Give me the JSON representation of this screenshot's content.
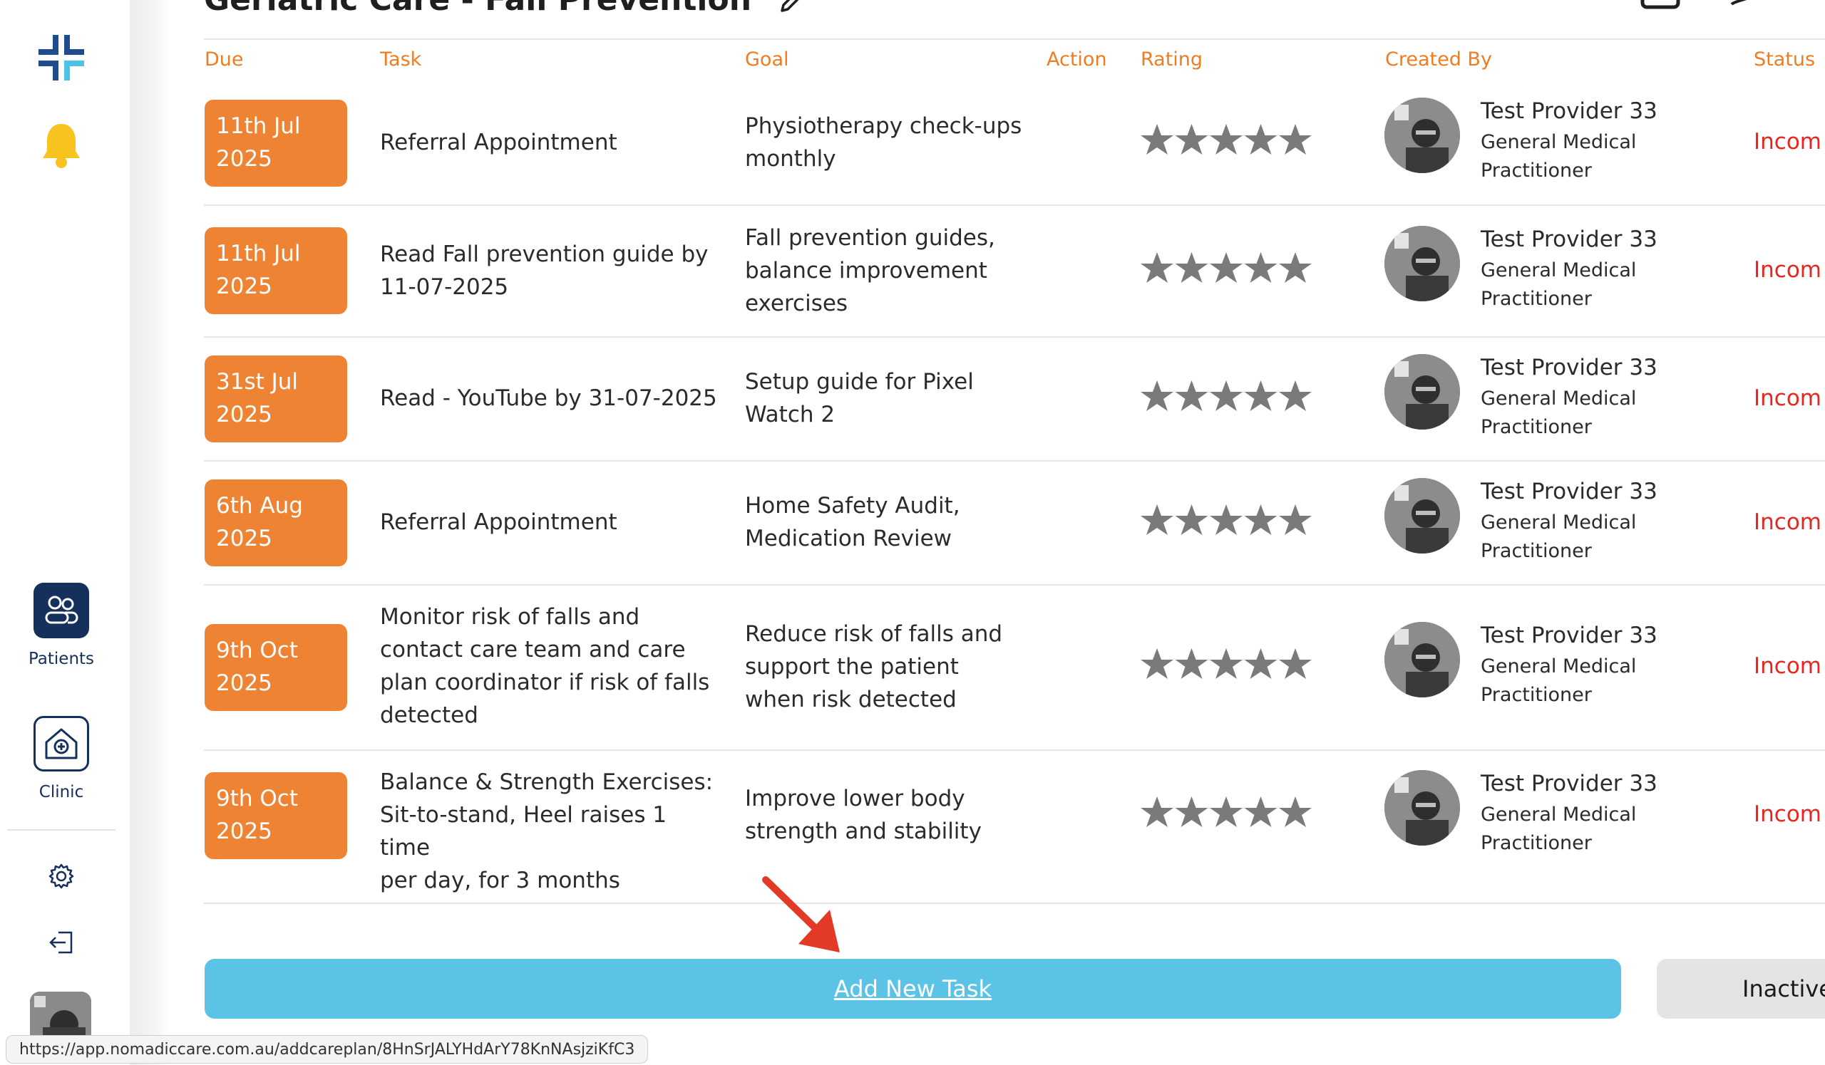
{
  "page": {
    "title": "Geriatric Care - Fall Prevention"
  },
  "nav": {
    "patients_label": "Patients",
    "clinic_label": "Clinic"
  },
  "table": {
    "headers": {
      "due": "Due",
      "task": "Task",
      "goal": "Goal",
      "action": "Action",
      "rating": "Rating",
      "created_by": "Created By",
      "status": "Status"
    },
    "rows": [
      {
        "due": [
          "11th Jul",
          "2025"
        ],
        "task": [
          "Referral Appointment"
        ],
        "goal": [
          "Physiotherapy check-ups",
          "monthly"
        ],
        "rating": 5,
        "creator_name": "Test Provider 33",
        "creator_role": [
          "General Medical",
          "Practitioner"
        ],
        "status": "Incom"
      },
      {
        "due": [
          "11th Jul",
          "2025"
        ],
        "task": [
          "Read Fall prevention guide by",
          "11-07-2025"
        ],
        "goal": [
          "Fall prevention guides,",
          "balance improvement",
          "exercises"
        ],
        "rating": 5,
        "creator_name": "Test Provider 33",
        "creator_role": [
          "General Medical",
          "Practitioner"
        ],
        "status": "Incom"
      },
      {
        "due": [
          "31st Jul",
          "2025"
        ],
        "task": [
          "Read - YouTube by 31-07-2025"
        ],
        "goal": [
          "Setup guide for Pixel",
          "Watch 2"
        ],
        "rating": 5,
        "creator_name": "Test Provider 33",
        "creator_role": [
          "General Medical",
          "Practitioner"
        ],
        "status": "Incom"
      },
      {
        "due": [
          "6th Aug",
          "2025"
        ],
        "task": [
          "Referral Appointment"
        ],
        "goal": [
          "Home Safety Audit,",
          "Medication Review"
        ],
        "rating": 5,
        "creator_name": "Test Provider 33",
        "creator_role": [
          "General Medical",
          "Practitioner"
        ],
        "status": "Incom"
      },
      {
        "due": [
          "9th Oct",
          "2025"
        ],
        "task": [
          "Monitor risk of falls and",
          "contact care team and care",
          "plan coordinator if risk of falls",
          "detected"
        ],
        "goal": [
          "Reduce risk of falls and",
          "support the patient",
          "when risk detected"
        ],
        "rating": 5,
        "creator_name": "Test Provider 33",
        "creator_role": [
          "General Medical",
          "Practitioner"
        ],
        "status": "Incom"
      },
      {
        "due": [
          "9th Oct",
          "2025"
        ],
        "task": [
          "Balance & Strength Exercises:",
          "Sit-to-stand, Heel raises 1 time",
          "per day, for 3 months"
        ],
        "goal": [
          "Improve lower body",
          "strength and stability"
        ],
        "rating": 5,
        "creator_name": "Test Provider 33",
        "creator_role": [
          "General Medical",
          "Practitioner"
        ],
        "status": "Incom"
      }
    ]
  },
  "buttons": {
    "add_task": "Add New Task",
    "inactive": "Inactive"
  },
  "status_url": "https://app.nomadiccare.com.au/addcareplan/8HnSrJALYHdArY78KnNAsjziKfC3",
  "colors": {
    "accent_orange": "#ee8433",
    "header_orange": "#ee7d22",
    "status_red": "#e8261f",
    "button_blue": "#5bc4e6",
    "navy": "#15305a",
    "star_gray": "#7a7a7a"
  }
}
